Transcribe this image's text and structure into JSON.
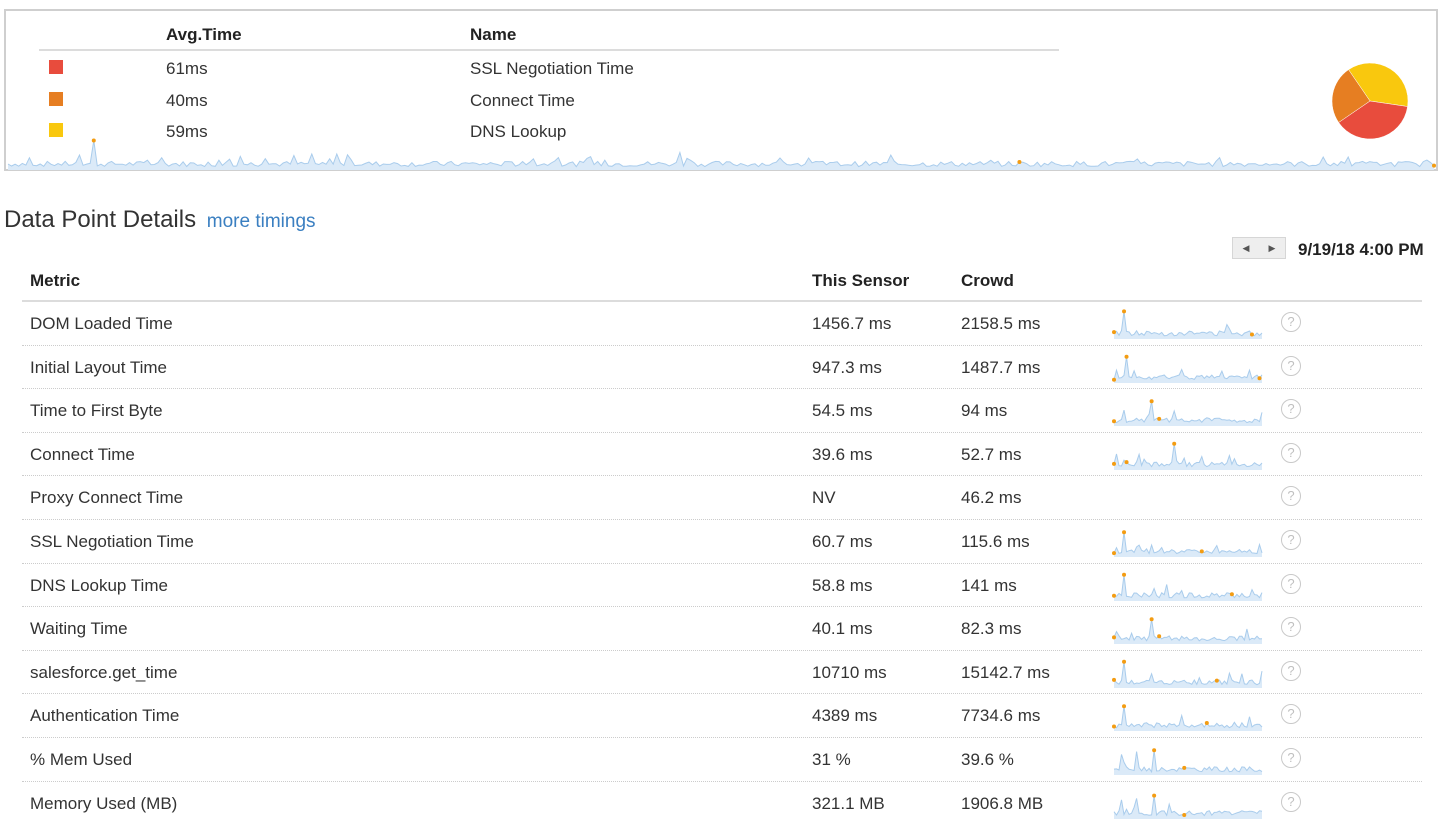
{
  "summary": {
    "headers": {
      "avg_time": "Avg.Time",
      "name": "Name"
    },
    "items": [
      {
        "color": "#e84c3d",
        "avg": "61ms",
        "name": "SSL Negotiation Time",
        "value": 61
      },
      {
        "color": "#e67e22",
        "avg": "40ms",
        "name": "Connect Time",
        "value": 40
      },
      {
        "color": "#f9c80e",
        "avg": "59ms",
        "name": "DNS Lookup",
        "value": 59
      }
    ]
  },
  "details": {
    "title": "Data Point Details",
    "more_timings": "more timings",
    "date": "9/19/18 4:00 PM",
    "nav": {
      "prev_icon": "triangle-left-icon",
      "next_icon": "triangle-right-icon"
    },
    "headers": {
      "metric": "Metric",
      "sensor": "This Sensor",
      "crowd": "Crowd"
    },
    "rows": [
      {
        "metric": "DOM Loaded Time",
        "sensor": "1456.7 ms",
        "crowd": "2158.5 ms",
        "spark": true
      },
      {
        "metric": "Initial Layout Time",
        "sensor": "947.3 ms",
        "crowd": "1487.7 ms",
        "spark": true
      },
      {
        "metric": "Time to First Byte",
        "sensor": "54.5 ms",
        "crowd": "94 ms",
        "spark": true
      },
      {
        "metric": "Connect Time",
        "sensor": "39.6 ms",
        "crowd": "52.7 ms",
        "spark": true
      },
      {
        "metric": "Proxy Connect Time",
        "sensor": "NV",
        "crowd": "46.2 ms",
        "spark": false
      },
      {
        "metric": "SSL Negotiation Time",
        "sensor": "60.7 ms",
        "crowd": "115.6 ms",
        "spark": true
      },
      {
        "metric": "DNS Lookup Time",
        "sensor": "58.8 ms",
        "crowd": "141 ms",
        "spark": true
      },
      {
        "metric": "Waiting Time",
        "sensor": "40.1 ms",
        "crowd": "82.3 ms",
        "spark": true
      },
      {
        "metric": "salesforce.get_time",
        "sensor": "10710 ms",
        "crowd": "15142.7 ms",
        "spark": true
      },
      {
        "metric": "Authentication Time",
        "sensor": "4389 ms",
        "crowd": "7734.6 ms",
        "spark": true
      },
      {
        "metric": "% Mem Used",
        "sensor": "31 %",
        "crowd": "39.6 %",
        "spark": true
      },
      {
        "metric": "Memory Used (MB)",
        "sensor": "321.1 MB",
        "crowd": "1906.8 MB",
        "spark": true
      }
    ],
    "help_glyph": "?"
  },
  "colors": {
    "accent": "#3a7fc1",
    "spark": "#a9ccec",
    "marker": "#f39c12"
  }
}
